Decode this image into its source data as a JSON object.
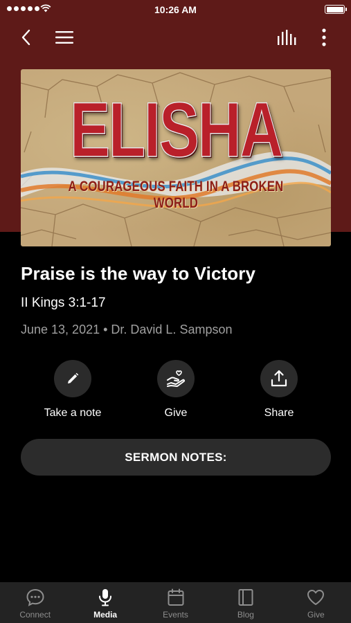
{
  "status": {
    "time": "10:26 AM"
  },
  "artwork": {
    "title": "ELISHA",
    "subtitle": "A COURAGEOUS FAITH IN A BROKEN WORLD"
  },
  "sermon": {
    "title": "Praise is the way to Victory",
    "scripture": "II Kings 3:1-17",
    "meta": "June 13, 2021 • Dr. David L. Sampson"
  },
  "actions": {
    "note_label": "Take a note",
    "give_label": "Give",
    "share_label": "Share"
  },
  "notes_button": {
    "label": "SERMON NOTES:"
  },
  "tabs": [
    {
      "label": "Connect",
      "icon": "chat-bubble-icon",
      "active": false
    },
    {
      "label": "Media",
      "icon": "microphone-icon",
      "active": true
    },
    {
      "label": "Events",
      "icon": "calendar-icon",
      "active": false
    },
    {
      "label": "Blog",
      "icon": "book-icon",
      "active": false
    },
    {
      "label": "Give",
      "icon": "heart-icon",
      "active": false
    }
  ],
  "colors": {
    "header_background": "#5e1a18",
    "page_background": "#000000",
    "button_background": "#2c2c2c",
    "tab_bar_background": "#232323"
  }
}
